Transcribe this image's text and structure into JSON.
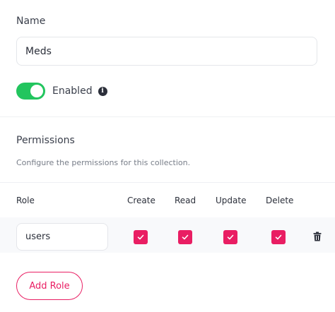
{
  "form": {
    "name_label": "Name",
    "name_value": "Meds",
    "enabled_label": "Enabled",
    "enabled": true,
    "accent": "#22c55e"
  },
  "permissions": {
    "title": "Permissions",
    "description": "Configure the permissions for this collection.",
    "columns": [
      "Role",
      "Create",
      "Read",
      "Update",
      "Delete"
    ],
    "rows": [
      {
        "role": "users",
        "create": true,
        "read": true,
        "update": true,
        "delete": true
      }
    ],
    "checkbox_color": "#e91e63",
    "add_role_label": "Add Role",
    "row_action_icon": "trash-icon"
  }
}
